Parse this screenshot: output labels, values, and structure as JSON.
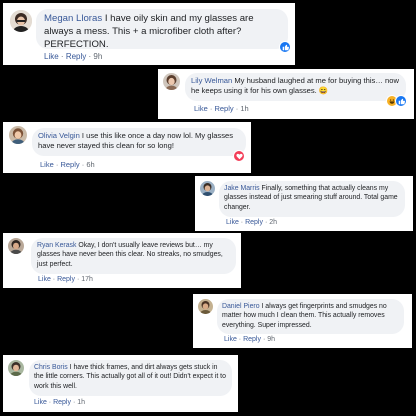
{
  "colors": {
    "name": "#385898",
    "bubble": "#f0f2f5",
    "like_blue": "#1877f2",
    "love_red": "#f33e58",
    "haha_yellow": "#f7b125"
  },
  "comments": [
    {
      "name": "Megan Lloras",
      "text": "I have oily skin and my glasses are always a mess. This + a microfiber cloth after? PERFECTION.",
      "like": "Like",
      "reply": "Reply",
      "sep": "·",
      "time": "9h",
      "reactions": [
        "like-icon"
      ]
    },
    {
      "name": "Lily Welman",
      "text": "My husband laughed at me for buying this… now he keeps using it for his own glasses.",
      "emoji": "😄",
      "like": "Like",
      "reply": "Reply",
      "sep": "·",
      "time": "1h",
      "reactions": [
        "haha-icon",
        "like-icon"
      ]
    },
    {
      "name": "Olivia Velgin",
      "text": "I use this like once a day now lol. My glasses have never stayed this clean for so long!",
      "like": "Like",
      "reply": "Reply",
      "sep": "·",
      "time": "6h",
      "reactions": [
        "love-icon"
      ]
    },
    {
      "name": "Jake Marris",
      "text": "Finally, something that actually cleans my glasses instead of just smearing stuff around. Total game changer.",
      "like": "Like",
      "reply": "Reply",
      "sep": "·",
      "time": "2h",
      "reactions": []
    },
    {
      "name": "Ryan Kerask",
      "text": "Okay, I don't usually leave reviews but… my glasses have never been this clear. No streaks, no smudges, just perfect.",
      "like": "Like",
      "reply": "Reply",
      "sep": "·",
      "time": "17h",
      "reactions": []
    },
    {
      "name": "Daniel Piero",
      "text": "I always get fingerprints and smudges no matter how much I clean them. This actually removes everything. Super impressed.",
      "like": "Like",
      "reply": "Reply",
      "sep": "·",
      "time": "9h",
      "reactions": []
    },
    {
      "name": "Chris Boris",
      "text": "I have thick frames, and dirt always gets stuck in the little corners. This actually got all of it out! Didn't expect it to work this well.",
      "like": "Like",
      "reply": "Reply",
      "sep": "·",
      "time": "1h",
      "reactions": []
    }
  ]
}
